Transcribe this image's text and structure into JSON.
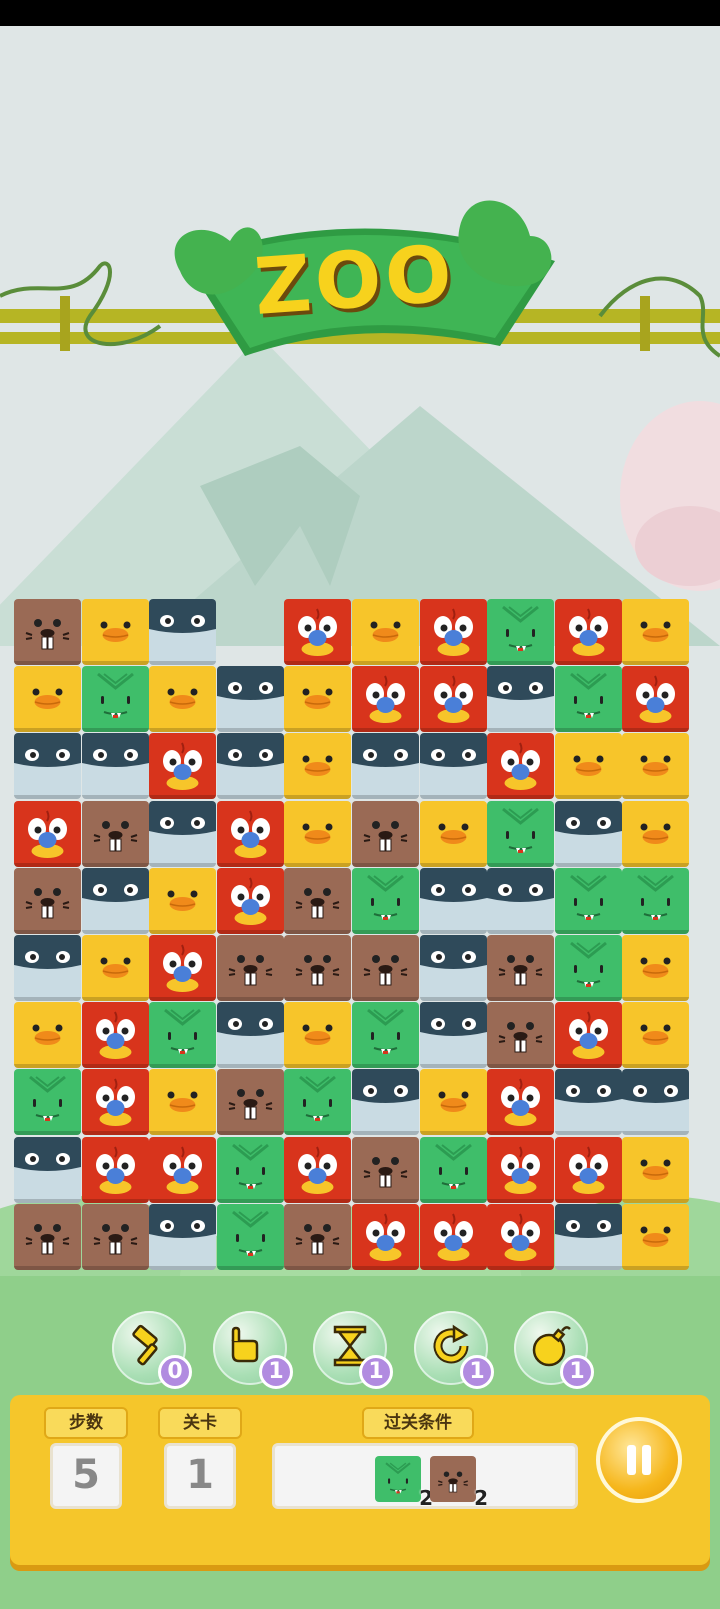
{
  "title": "ZOO",
  "colors": {
    "beaver": "#9a6a55",
    "duck": "#f7c52a",
    "whale": "#c9dbe3",
    "parrot": "#d8341c",
    "croc": "#3fbe6a",
    "panel": "#f5c62b",
    "counter_badge": "#b18be0"
  },
  "board": {
    "rows": [
      [
        "beaver",
        "duck",
        "whale",
        "empty",
        "parrot",
        "duck",
        "parrot",
        "croc",
        "parrot",
        "duck"
      ],
      [
        "duck",
        "croc",
        "duck",
        "whale",
        "duck",
        "parrot",
        "parrot",
        "whale",
        "croc",
        "parrot"
      ],
      [
        "whale",
        "whale",
        "parrot",
        "whale",
        "duck",
        "whale",
        "whale",
        "parrot",
        "duck",
        "duck"
      ],
      [
        "parrot",
        "beaver",
        "whale",
        "parrot",
        "duck",
        "beaver",
        "duck",
        "croc",
        "whale",
        "duck"
      ],
      [
        "beaver",
        "whale",
        "duck",
        "parrot",
        "beaver",
        "croc",
        "whale",
        "whale",
        "croc",
        "croc"
      ],
      [
        "whale",
        "duck",
        "parrot",
        "beaver",
        "beaver",
        "beaver",
        "whale",
        "beaver",
        "croc",
        "duck"
      ],
      [
        "duck",
        "parrot",
        "croc",
        "whale",
        "duck",
        "croc",
        "whale",
        "beaver",
        "parrot",
        "duck"
      ],
      [
        "croc",
        "parrot",
        "duck",
        "beaver",
        "croc",
        "whale",
        "duck",
        "parrot",
        "whale",
        "whale"
      ],
      [
        "whale",
        "parrot",
        "parrot",
        "croc",
        "parrot",
        "beaver",
        "croc",
        "parrot",
        "parrot",
        "duck"
      ],
      [
        "beaver",
        "beaver",
        "whale",
        "croc",
        "beaver",
        "parrot",
        "parrot",
        "parrot",
        "whale",
        "duck"
      ]
    ]
  },
  "tools": [
    {
      "icon": "hammer-icon",
      "count": "0"
    },
    {
      "icon": "hand-swap-icon",
      "count": "1"
    },
    {
      "icon": "hourglass-icon",
      "count": "1"
    },
    {
      "icon": "refresh-icon",
      "count": "1"
    },
    {
      "icon": "bomb-icon",
      "count": "1"
    }
  ],
  "panel": {
    "moves_label": "步数",
    "moves_value": "5",
    "level_label": "关卡",
    "level_value": "1",
    "goal_label": "过关条件",
    "goals": [
      {
        "animal": "croc",
        "count": "2"
      },
      {
        "animal": "beaver",
        "count": "2"
      }
    ]
  }
}
